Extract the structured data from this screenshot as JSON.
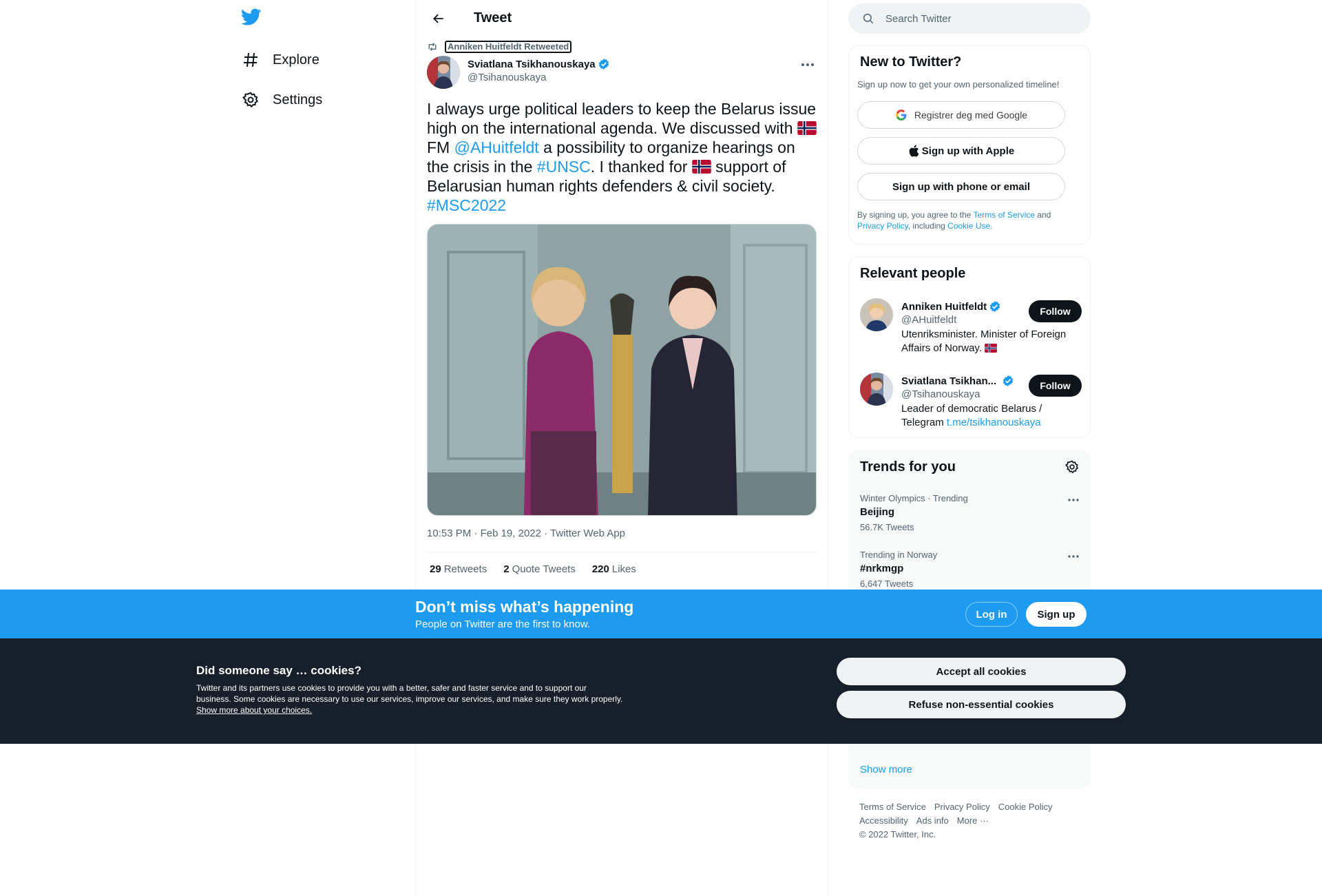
{
  "nav": {
    "items": [
      {
        "label": "Explore",
        "icon": "hashtag-icon"
      },
      {
        "label": "Settings",
        "icon": "gear-icon"
      }
    ]
  },
  "header": {
    "title": "Tweet"
  },
  "tweet": {
    "retweeted_by": "Anniken Huitfeldt Retweeted",
    "author_name": "Sviatlana Tsikhanouskaya",
    "author_handle": "@Tsihanouskaya",
    "text_parts": {
      "p1": "I always urge political leaders to keep the Belarus issue high on the international agenda. We discussed with ",
      "p2": " FM ",
      "mention": "@AHuitfeldt",
      "p3": " a possibility to organize hearings on the crisis in the ",
      "hashtag1": "#UNSC",
      "p4": ". I thanked for ",
      "p5": " support of Belarusian human rights defenders & civil society. ",
      "hashtag2": "#MSC2022"
    },
    "time": "10:53 PM",
    "date": "Feb 19, 2022",
    "source": "Twitter Web App",
    "meta_separator": " · ",
    "stats": [
      {
        "count": "29",
        "label": "Retweets"
      },
      {
        "count": "2",
        "label": "Quote Tweets"
      },
      {
        "count": "220",
        "label": "Likes"
      }
    ]
  },
  "search": {
    "placeholder": "Search Twitter"
  },
  "new_to_twitter": {
    "title": "New to Twitter?",
    "subtitle": "Sign up now to get your own personalized timeline!",
    "google_label": "Registrer deg med Google",
    "apple_label": "Sign up with Apple",
    "phone_label": "Sign up with phone or email",
    "terms": {
      "t1": "By signing up, you agree to the ",
      "tos": "Terms of Service",
      "t2": " and ",
      "privacy": "Privacy Policy",
      "t3": ", including ",
      "cookie": "Cookie Use."
    }
  },
  "relevant_people": {
    "title": "Relevant people",
    "people": [
      {
        "name": "Anniken Huitfeldt",
        "handle": "@AHuitfeldt",
        "bio": "Utenriksminister. Minister of Foreign Affairs of Norway. ",
        "bio_link": "",
        "follow": "Follow"
      },
      {
        "name": "Sviatlana Tsikhan...",
        "handle": "@Tsihanouskaya",
        "bio": "Leader of democratic Belarus / Telegram ",
        "bio_link": "t.me/tsikhanouskaya",
        "follow": "Follow"
      }
    ]
  },
  "trends": {
    "title": "Trends for you",
    "items": [
      {
        "context": "Winter Olympics · Trending",
        "name": "Beijing",
        "count": "56.7K Tweets"
      },
      {
        "context": "Trending in Norway",
        "name": "#nrkmgp",
        "count": "6,647 Tweets"
      }
    ],
    "show_more": "Show more"
  },
  "footer": {
    "row1": [
      "Terms of Service",
      "Privacy Policy",
      "Cookie Policy"
    ],
    "row2": [
      "Accessibility",
      "Ads info",
      "More ···"
    ],
    "copyright": "© 2022 Twitter, Inc."
  },
  "banner": {
    "title": "Don’t miss what’s happening",
    "subtitle": "People on Twitter are the first to know.",
    "login": "Log in",
    "signup": "Sign up"
  },
  "cookies": {
    "title": "Did someone say … cookies?",
    "text": "Twitter and its partners use cookies to provide you with a better, safer and faster service and to support our business. Some cookies are necessary to use our services, improve our services, and make sure they work properly. ",
    "link": "Show more about your choices.",
    "accept": "Accept all cookies",
    "refuse": "Refuse non-essential cookies"
  },
  "colors": {
    "accent": "#1d9bf0",
    "text": "#0f1419",
    "muted": "#536471",
    "cookie_bg": "#17202a"
  }
}
